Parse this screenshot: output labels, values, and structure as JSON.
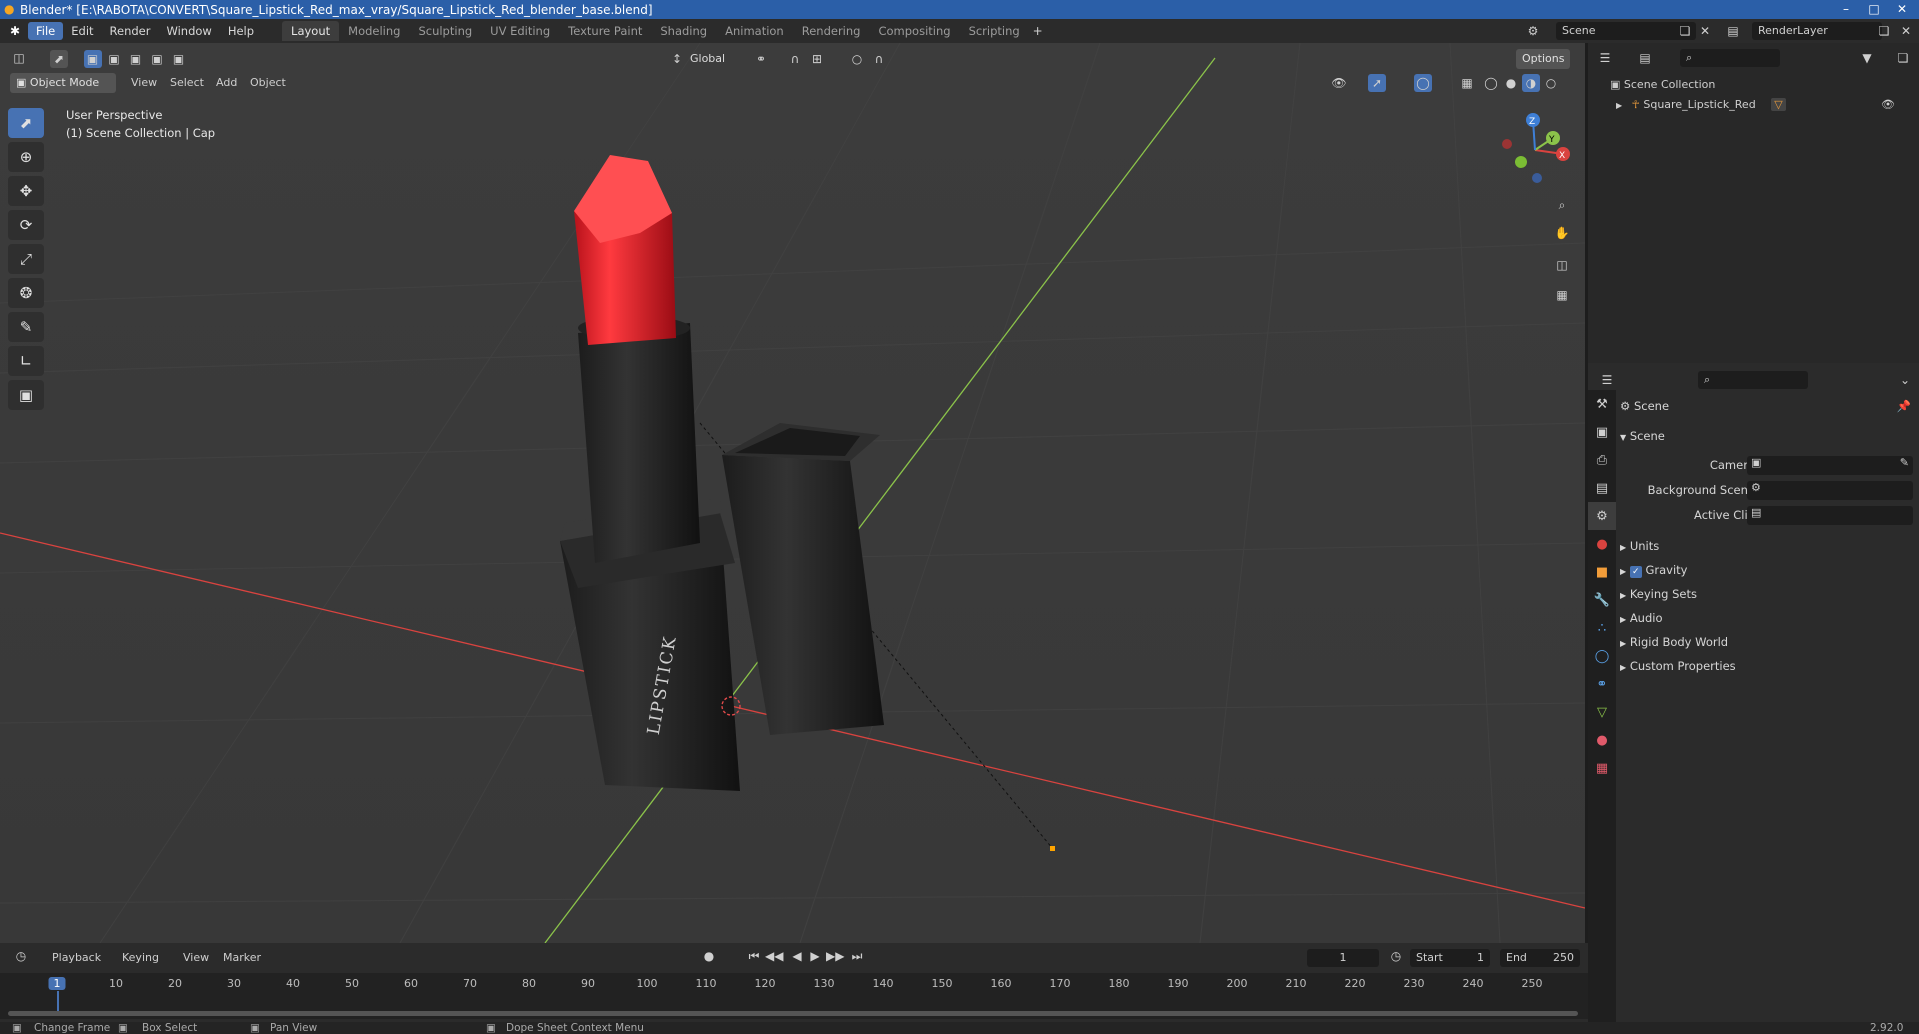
{
  "window": {
    "title": "Blender* [E:\\RABOTA\\CONVERT\\Square_Lipstick_Red_max_vray/Square_Lipstick_Red_blender_base.blend]"
  },
  "menu": [
    "File",
    "Edit",
    "Render",
    "Window",
    "Help"
  ],
  "workspaces": [
    "Layout",
    "Modeling",
    "Sculpting",
    "UV Editing",
    "Texture Paint",
    "Shading",
    "Animation",
    "Rendering",
    "Compositing",
    "Scripting"
  ],
  "active_workspace": "Layout",
  "scene_selector": "Scene",
  "viewlayer_selector": "RenderLayer",
  "viewport": {
    "mode": "Object Mode",
    "menus": [
      "View",
      "Select",
      "Add",
      "Object"
    ],
    "transform_orientation": "Global",
    "options_label": "Options",
    "overlay_line1": "User Perspective",
    "overlay_line2": "(1) Scene Collection | Cap",
    "gizmo_x": "X",
    "gizmo_y": "Y",
    "gizmo_z": "Z",
    "lipstick_text": "LIPSTICK"
  },
  "outliner": {
    "root": "Scene Collection",
    "items": [
      {
        "label": "Square_Lipstick_Red"
      }
    ]
  },
  "properties": {
    "header": "Scene",
    "panel": "Scene",
    "fields": {
      "camera": "Camera",
      "background_scene": "Background Scene",
      "active_clip": "Active Clip"
    },
    "sections": [
      "Units",
      "Gravity",
      "Keying Sets",
      "Audio",
      "Rigid Body World",
      "Custom Properties"
    ],
    "gravity_checked": true
  },
  "timeline": {
    "menus": [
      "Playback",
      "Keying",
      "View",
      "Marker"
    ],
    "current_frame": "1",
    "start_label": "Start",
    "start_value": "1",
    "end_label": "End",
    "end_value": "250",
    "ticks": [
      "1",
      "10",
      "20",
      "30",
      "40",
      "50",
      "60",
      "70",
      "80",
      "90",
      "100",
      "110",
      "120",
      "130",
      "140",
      "150",
      "160",
      "170",
      "180",
      "190",
      "200",
      "210",
      "220",
      "230",
      "240",
      "250"
    ]
  },
  "status": {
    "items": [
      "Change Frame",
      "Box Select",
      "Pan View",
      "Dope Sheet Context Menu"
    ],
    "version": "2.92.0"
  },
  "colors": {
    "accent": "#4772b3",
    "titlebar": "#2b5fa8",
    "x_axis": "#d9433f",
    "y_axis": "#8bc34a",
    "lipstick_red": "#e8202a"
  }
}
